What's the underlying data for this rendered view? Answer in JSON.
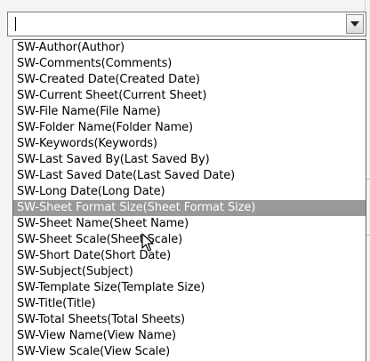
{
  "combo": {
    "value": "",
    "dropdown_icon": "chevron-down-icon"
  },
  "dropdown": {
    "items": [
      {
        "label": "SW-Author(Author)"
      },
      {
        "label": "SW-Comments(Comments)"
      },
      {
        "label": "SW-Created Date(Created Date)"
      },
      {
        "label": "SW-Current Sheet(Current Sheet)"
      },
      {
        "label": "SW-File Name(File Name)"
      },
      {
        "label": "SW-Folder Name(Folder Name)"
      },
      {
        "label": "SW-Keywords(Keywords)"
      },
      {
        "label": "SW-Last Saved By(Last Saved By)"
      },
      {
        "label": "SW-Last Saved Date(Last Saved Date)"
      },
      {
        "label": "SW-Long Date(Long Date)"
      },
      {
        "label": "SW-Sheet Format Size(Sheet Format Size)"
      },
      {
        "label": "SW-Sheet Name(Sheet Name)"
      },
      {
        "label": "SW-Sheet Scale(Sheet Scale)"
      },
      {
        "label": "SW-Short Date(Short Date)"
      },
      {
        "label": "SW-Subject(Subject)"
      },
      {
        "label": "SW-Template Size(Template Size)"
      },
      {
        "label": "SW-Title(Title)"
      },
      {
        "label": "SW-Total Sheets(Total Sheets)"
      },
      {
        "label": "SW-View Name(View Name)"
      },
      {
        "label": "SW-View Scale(View Scale)"
      }
    ],
    "selected_index": 10,
    "highlight_color": "#999999"
  },
  "cursor_icon": "mouse-pointer-icon"
}
